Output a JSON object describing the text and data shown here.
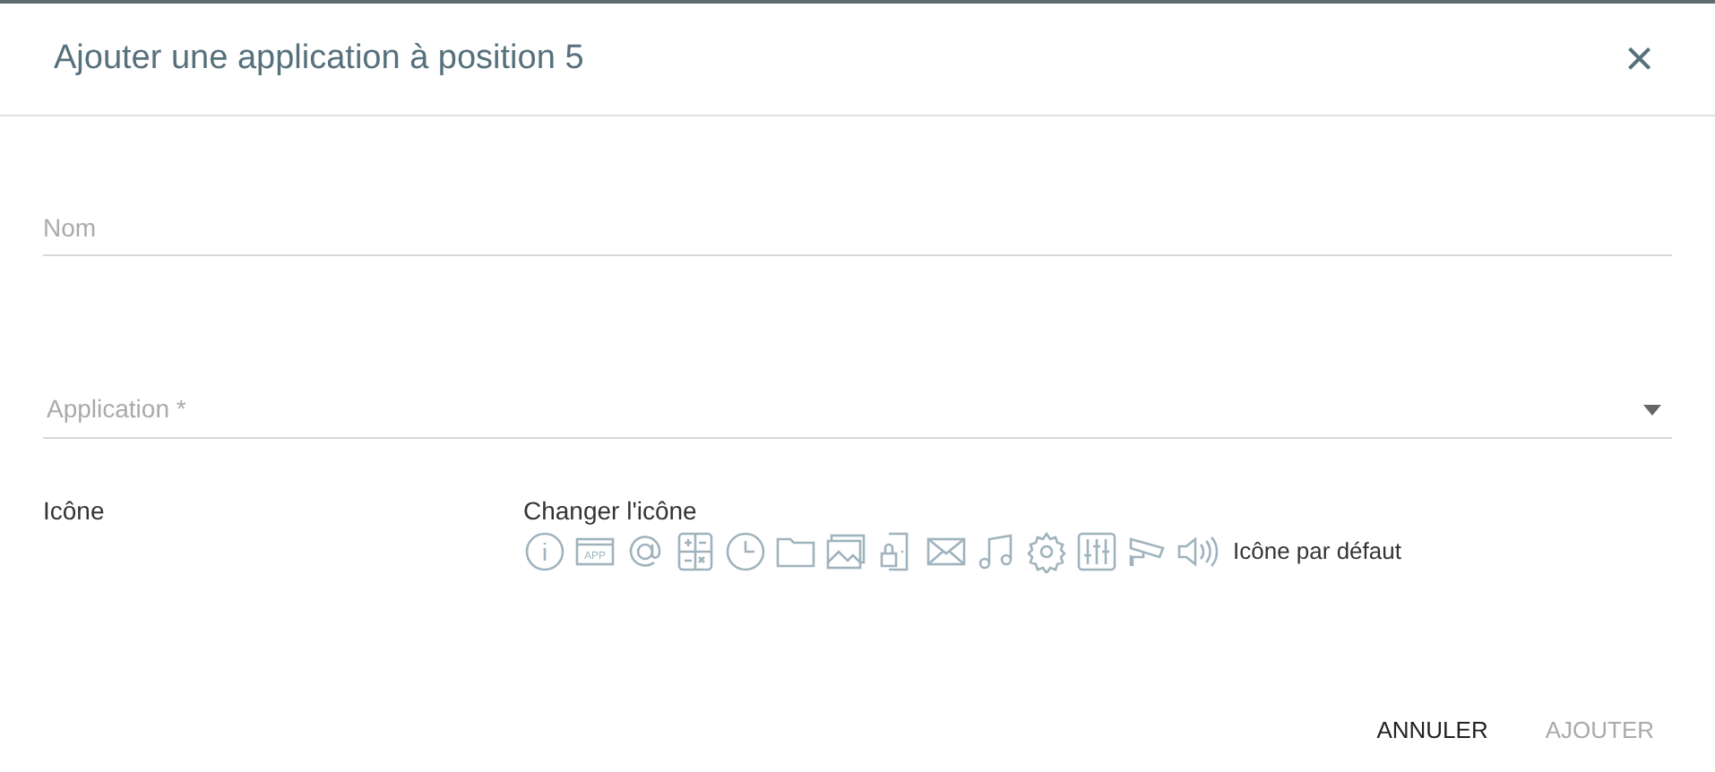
{
  "dialog": {
    "title": "Ajouter une application à position 5",
    "close": "×"
  },
  "fields": [
    {
      "kind": "text",
      "placeholder": "Nom"
    },
    {
      "kind": "select",
      "placeholder": "Application *"
    }
  ],
  "icon_section": {
    "label": "Icône",
    "change_label": "Changer l'icône",
    "icons": [
      {
        "kind": "info"
      },
      {
        "kind": "app",
        "label": "APP"
      },
      {
        "kind": "at"
      },
      {
        "kind": "calculator"
      },
      {
        "kind": "clock"
      },
      {
        "kind": "folder"
      },
      {
        "kind": "image"
      },
      {
        "kind": "lock"
      },
      {
        "kind": "mail"
      },
      {
        "kind": "music"
      },
      {
        "kind": "gear"
      },
      {
        "kind": "sliders"
      },
      {
        "kind": "camera"
      },
      {
        "kind": "speaker"
      }
    ],
    "default_label": "Icône par défaut"
  },
  "buttons": [
    {
      "label": "ANNULER",
      "disabled": false
    },
    {
      "label": "AJOUTER",
      "disabled": true
    }
  ]
}
